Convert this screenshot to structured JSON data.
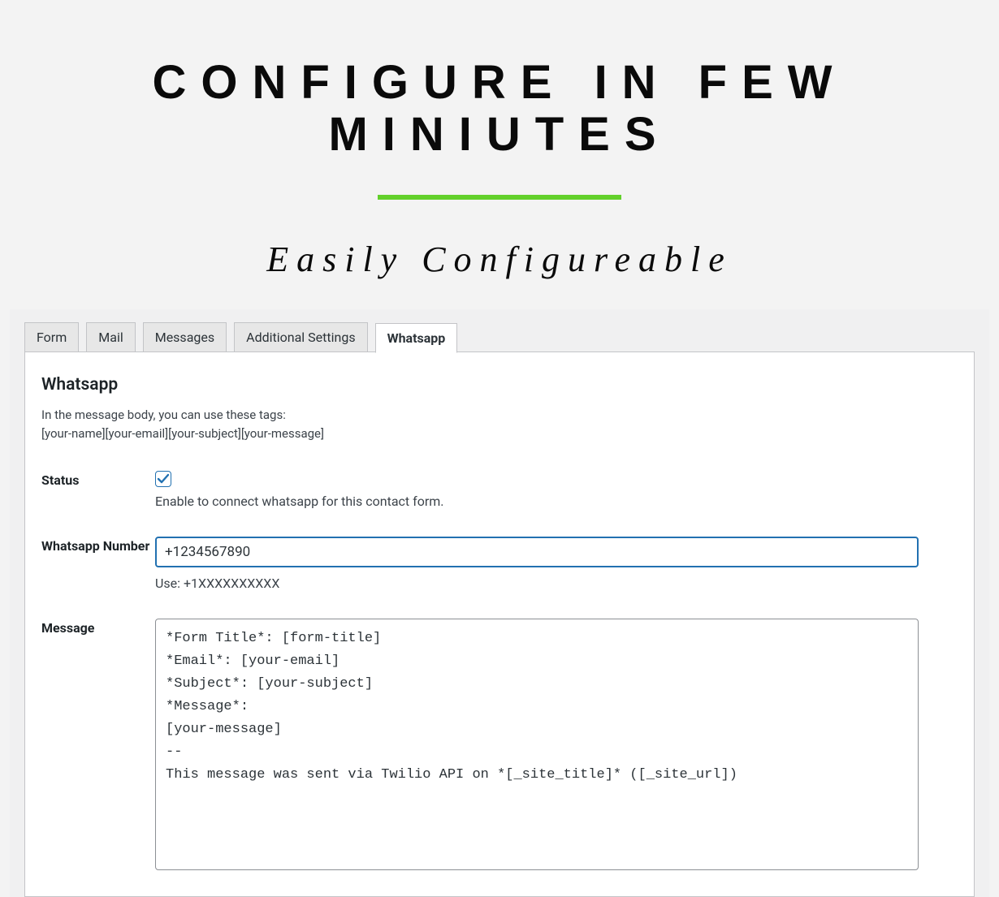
{
  "hero": {
    "title": "CONFIGURE IN FEW MINIUTES",
    "subtitle": "Easily Configureable"
  },
  "tabs": [
    {
      "label": "Form",
      "active": false
    },
    {
      "label": "Mail",
      "active": false
    },
    {
      "label": "Messages",
      "active": false
    },
    {
      "label": "Additional Settings",
      "active": false
    },
    {
      "label": "Whatsapp",
      "active": true
    }
  ],
  "panel": {
    "heading": "Whatsapp",
    "hint_line1": "In the message body, you can use these tags:",
    "hint_tags": "[your-name][your-email][your-subject][your-message]",
    "status": {
      "label": "Status",
      "checked": true,
      "help": "Enable to connect whatsapp for this contact form."
    },
    "number": {
      "label": "Whatsapp Number",
      "value": "+1234567890",
      "hint": "Use: +1XXXXXXXXXX"
    },
    "message": {
      "label": "Message",
      "value": "*Form Title*: [form-title]\n*Email*: [your-email]\n*Subject*: [your-subject]\n*Message*:\n[your-message]\n--\nThis message was sent via Twilio API on *[_site_title]* ([_site_url])"
    }
  }
}
